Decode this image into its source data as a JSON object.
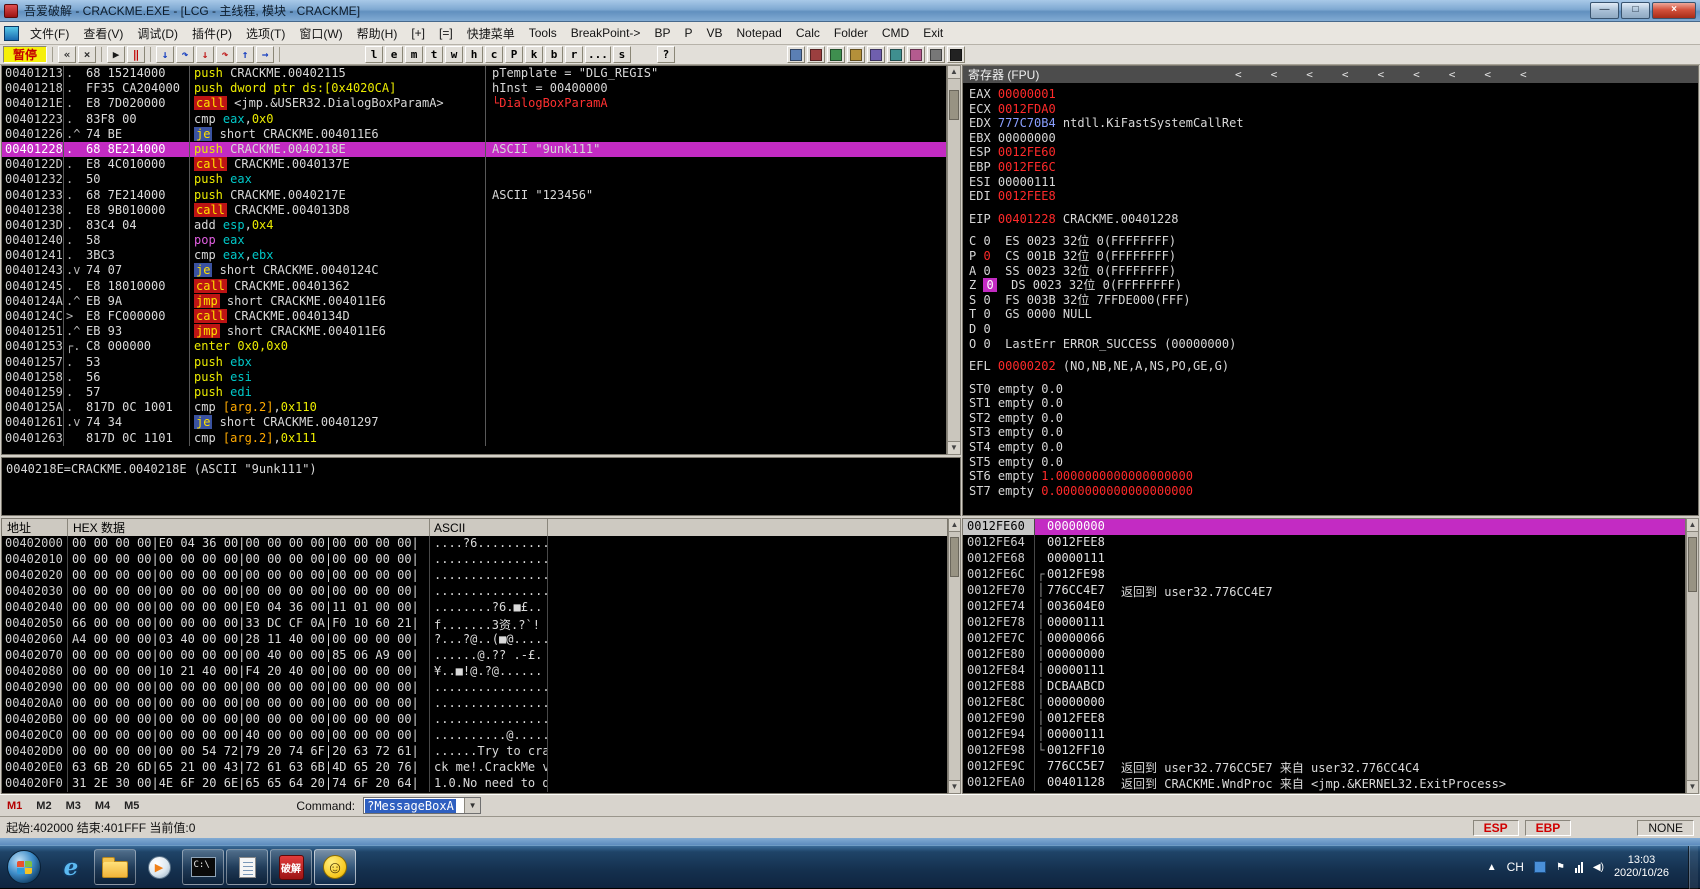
{
  "window": {
    "title": "吾爱破解 - CRACKME.EXE - [LCG - 主线程, 模块 - CRACKME]",
    "min_label": "—",
    "max_label": "□",
    "close_label": "×"
  },
  "menu": {
    "items": [
      "文件(F)",
      "查看(V)",
      "调试(D)",
      "插件(P)",
      "选项(T)",
      "窗口(W)",
      "帮助(H)",
      "[+]",
      "[=]",
      "快捷菜单",
      "Tools",
      "BreakPoint->",
      "BP",
      "P",
      "VB",
      "Notepad",
      "Calc",
      "Folder",
      "CMD",
      "Exit"
    ]
  },
  "toolbar": {
    "status": "暂停",
    "icon_buttons": [
      {
        "name": "restart-icon",
        "glyph": "«",
        "color": "#303030"
      },
      {
        "name": "close-program-icon",
        "glyph": "×",
        "color": "#303030"
      },
      {
        "name": "run-icon",
        "glyph": "▶",
        "color": "#1a1a1a"
      },
      {
        "name": "pause-icon",
        "glyph": "‖",
        "color": "#c00000"
      },
      {
        "name": "step-into-icon",
        "glyph": "↓",
        "color": "#1840c0"
      },
      {
        "name": "step-over-icon",
        "glyph": "↷",
        "color": "#1840c0"
      },
      {
        "name": "animate-into-icon",
        "glyph": "↓",
        "color": "#c02020"
      },
      {
        "name": "animate-over-icon",
        "glyph": "↷",
        "color": "#c02020"
      },
      {
        "name": "execute-till-return-icon",
        "glyph": "↑",
        "color": "#1840c0"
      },
      {
        "name": "go-to-user-code-icon",
        "glyph": "→",
        "color": "#1840c0"
      }
    ],
    "letter_buttons": [
      "l",
      "e",
      "m",
      "t",
      "w",
      "h",
      "c",
      "P",
      "k",
      "b",
      "r",
      "...",
      "s"
    ],
    "help_button": "?",
    "plugin_buttons": [
      {
        "name": "plugin-icon-1",
        "color": "#5b7fb4"
      },
      {
        "name": "plugin-icon-2",
        "color": "#9b3f3f"
      },
      {
        "name": "plugin-icon-3",
        "color": "#3f8f4f"
      },
      {
        "name": "plugin-icon-4",
        "color": "#b4903a"
      },
      {
        "name": "plugin-icon-5",
        "color": "#6f5fae"
      },
      {
        "name": "plugin-icon-6",
        "color": "#3f8f8f"
      },
      {
        "name": "plugin-icon-7",
        "color": "#b45b8f"
      },
      {
        "name": "plugin-icon-8",
        "color": "#777777"
      },
      {
        "name": "plugin-icon-9",
        "color": "#222222"
      }
    ]
  },
  "disasm": {
    "rows": [
      {
        "a": "00401213",
        "m": ".",
        "b": "68 15214000",
        "i": [
          [
            "y",
            "push"
          ],
          [
            "w",
            " CRACKME.00402115"
          ]
        ],
        "c": "pTemplate = \"DLG_REGIS\"",
        "cc": "cw"
      },
      {
        "a": "00401218",
        "m": ".",
        "b": "FF35 CA204000",
        "i": [
          [
            "y",
            "push"
          ],
          [
            "y",
            " dword ptr ds:[0x4020CA]"
          ]
        ],
        "c": "hInst = 00400000",
        "cc": "cw"
      },
      {
        "a": "0040121E",
        "m": ".",
        "b": "E8 7D020000",
        "i": [
          [
            "kc",
            "call"
          ],
          [
            "w",
            " <jmp.&USER32.DialogBoxParamA>"
          ]
        ],
        "c": "└DialogBoxParamA",
        "cc": "cr"
      },
      {
        "a": "00401223",
        "m": ".",
        "b": "83F8 00",
        "i": [
          [
            "w",
            "cmp "
          ],
          [
            "c",
            "eax"
          ],
          [
            "w",
            ","
          ],
          [
            "y",
            "0x0"
          ]
        ]
      },
      {
        "a": "00401226",
        "m": ".^",
        "b": "74 BE",
        "i": [
          [
            "ke",
            "je"
          ],
          [
            "w",
            " short CRACKME.004011E6"
          ]
        ]
      },
      {
        "a": "00401228",
        "m": ".",
        "b": "68 8E214000",
        "i": [
          [
            "y",
            "push"
          ],
          [
            "w",
            " CRACKME.0040218E"
          ]
        ],
        "c": "ASCII \"9unk111\"",
        "cc": "cw",
        "hl": true
      },
      {
        "a": "0040122D",
        "m": ".",
        "b": "E8 4C010000",
        "i": [
          [
            "kc",
            "call"
          ],
          [
            "w",
            " CRACKME.0040137E"
          ]
        ]
      },
      {
        "a": "00401232",
        "m": ".",
        "b": "50",
        "i": [
          [
            "y",
            "push"
          ],
          [
            "c",
            " eax"
          ]
        ]
      },
      {
        "a": "00401233",
        "m": ".",
        "b": "68 7E214000",
        "i": [
          [
            "y",
            "push"
          ],
          [
            "w",
            " CRACKME.0040217E"
          ]
        ],
        "c": "ASCII \"123456\"",
        "cc": "cw"
      },
      {
        "a": "00401238",
        "m": ".",
        "b": "E8 9B010000",
        "i": [
          [
            "kc",
            "call"
          ],
          [
            "w",
            " CRACKME.004013D8"
          ]
        ]
      },
      {
        "a": "0040123D",
        "m": ".",
        "b": "83C4 04",
        "i": [
          [
            "w",
            "add "
          ],
          [
            "c",
            "esp"
          ],
          [
            "w",
            ","
          ],
          [
            "y",
            "0x4"
          ]
        ]
      },
      {
        "a": "00401240",
        "m": ".",
        "b": "58",
        "i": [
          [
            "p",
            "pop"
          ],
          [
            "c",
            " eax"
          ]
        ]
      },
      {
        "a": "00401241",
        "m": ".",
        "b": "3BC3",
        "i": [
          [
            "w",
            "cmp "
          ],
          [
            "c",
            "eax"
          ],
          [
            "w",
            ","
          ],
          [
            "c",
            "ebx"
          ]
        ]
      },
      {
        "a": "00401243",
        "m": ".v",
        "b": "74 07",
        "i": [
          [
            "ke",
            "je"
          ],
          [
            "w",
            " short CRACKME.0040124C"
          ]
        ]
      },
      {
        "a": "00401245",
        "m": ".",
        "b": "E8 18010000",
        "i": [
          [
            "kc",
            "call"
          ],
          [
            "w",
            " CRACKME.00401362"
          ]
        ]
      },
      {
        "a": "0040124A",
        "m": ".^",
        "b": "EB 9A",
        "i": [
          [
            "kj",
            "jmp"
          ],
          [
            "w",
            " short CRACKME.004011E6"
          ]
        ]
      },
      {
        "a": "0040124C",
        "m": ">",
        "b": "E8 FC000000",
        "i": [
          [
            "kc",
            "call"
          ],
          [
            "w",
            " CRACKME.0040134D"
          ]
        ]
      },
      {
        "a": "00401251",
        "m": ".^",
        "b": "EB 93",
        "i": [
          [
            "kj",
            "jmp"
          ],
          [
            "w",
            " short CRACKME.004011E6"
          ]
        ]
      },
      {
        "a": "00401253",
        "m": "┌.",
        "b": "C8 000000",
        "i": [
          [
            "y",
            "enter"
          ],
          [
            "y",
            " 0x0,0x0"
          ]
        ]
      },
      {
        "a": "00401257",
        "m": ".",
        "b": "53",
        "i": [
          [
            "y",
            "push"
          ],
          [
            "c",
            " ebx"
          ]
        ]
      },
      {
        "a": "00401258",
        "m": ".",
        "b": "56",
        "i": [
          [
            "y",
            "push"
          ],
          [
            "c",
            " esi"
          ]
        ]
      },
      {
        "a": "00401259",
        "m": ".",
        "b": "57",
        "i": [
          [
            "y",
            "push"
          ],
          [
            "c",
            " edi"
          ]
        ]
      },
      {
        "a": "0040125A",
        "m": ".",
        "b": "817D 0C 1001",
        "i": [
          [
            "w",
            "cmp "
          ],
          [
            "o",
            "[arg.2]"
          ],
          [
            "w",
            ","
          ],
          [
            "y",
            "0x110"
          ]
        ]
      },
      {
        "a": "00401261",
        "m": ".v",
        "b": "74 34",
        "i": [
          [
            "ke",
            "je"
          ],
          [
            "w",
            " short CRACKME.00401297"
          ]
        ]
      },
      {
        "a": "00401263",
        "m": "",
        "b": "817D 0C 1101",
        "i": [
          [
            "w",
            "cmp "
          ],
          [
            "o",
            "[arg.2]"
          ],
          [
            "w",
            ","
          ],
          [
            "y",
            "0x111"
          ]
        ]
      }
    ]
  },
  "info_pane": {
    "text": "0040218E=CRACKME.0040218E (ASCII \"9unk111\")"
  },
  "registers": {
    "title": "寄存器 (FPU)",
    "chevron": "<",
    "chevron_count": 9,
    "lines": [
      {
        "s": [
          [
            "w",
            "EAX "
          ],
          [
            "r",
            "00000001"
          ]
        ]
      },
      {
        "s": [
          [
            "w",
            "ECX "
          ],
          [
            "r",
            "0012FDA0"
          ]
        ]
      },
      {
        "s": [
          [
            "w",
            "EDX "
          ],
          [
            "b",
            "777C70B4"
          ],
          [
            "w",
            " ntdll.KiFastSystemCallRet"
          ]
        ]
      },
      {
        "s": [
          [
            "w",
            "EBX "
          ],
          [
            "w",
            "00000000"
          ]
        ]
      },
      {
        "s": [
          [
            "w",
            "ESP "
          ],
          [
            "r",
            "0012FE60"
          ]
        ]
      },
      {
        "s": [
          [
            "w",
            "EBP "
          ],
          [
            "r",
            "0012FE6C"
          ]
        ]
      },
      {
        "s": [
          [
            "w",
            "ESI "
          ],
          [
            "w",
            "00000111"
          ]
        ]
      },
      {
        "s": [
          [
            "w",
            "EDI "
          ],
          [
            "r",
            "0012FEE8"
          ]
        ]
      },
      {
        "gap": true
      },
      {
        "s": [
          [
            "w",
            "EIP "
          ],
          [
            "r",
            "00401228"
          ],
          [
            "w",
            " CRACKME.00401228"
          ]
        ]
      },
      {
        "gap": true
      },
      {
        "s": [
          [
            "w",
            "C 0  ES 0023 32位 0(FFFFFFFF)"
          ]
        ]
      },
      {
        "s": [
          [
            "w",
            "P "
          ],
          [
            "r",
            "0"
          ],
          [
            "w",
            "  CS 001B 32位 0(FFFFFFFF)"
          ]
        ]
      },
      {
        "s": [
          [
            "w",
            "A 0  SS 0023 32位 0(FFFFFFFF)"
          ]
        ]
      },
      {
        "s": [
          [
            "w",
            "Z "
          ],
          [
            "zm",
            "0"
          ],
          [
            "w",
            "  DS 0023 32位 0(FFFFFFFF)"
          ]
        ]
      },
      {
        "s": [
          [
            "w",
            "S 0  FS 003B 32位 7FFDE000(FFF)"
          ]
        ]
      },
      {
        "s": [
          [
            "w",
            "T 0  GS 0000 NULL"
          ]
        ]
      },
      {
        "s": [
          [
            "w",
            "D 0"
          ]
        ]
      },
      {
        "s": [
          [
            "w",
            "O 0  LastErr ERROR_SUCCESS (00000000)"
          ]
        ]
      },
      {
        "gap": true
      },
      {
        "s": [
          [
            "w",
            "EFL "
          ],
          [
            "r",
            "00000202"
          ],
          [
            "w",
            " (NO,NB,NE,A,NS,PO,GE,G)"
          ]
        ]
      },
      {
        "gap": true
      },
      {
        "s": [
          [
            "w",
            "ST0 empty 0.0"
          ]
        ]
      },
      {
        "s": [
          [
            "w",
            "ST1 empty 0.0"
          ]
        ]
      },
      {
        "s": [
          [
            "w",
            "ST2 empty 0.0"
          ]
        ]
      },
      {
        "s": [
          [
            "w",
            "ST3 empty 0.0"
          ]
        ]
      },
      {
        "s": [
          [
            "w",
            "ST4 empty 0.0"
          ]
        ]
      },
      {
        "s": [
          [
            "w",
            "ST5 empty 0.0"
          ]
        ]
      },
      {
        "s": [
          [
            "w",
            "ST6 empty "
          ],
          [
            "r",
            "1.0000000000000000000"
          ]
        ]
      },
      {
        "s": [
          [
            "w",
            "ST7 empty "
          ],
          [
            "r",
            "0.0000000000000000000"
          ]
        ]
      }
    ]
  },
  "dump": {
    "headers": {
      "addr": "地址",
      "hex": "HEX 数据",
      "ascii": "ASCII"
    },
    "rows": [
      {
        "a": "00402000",
        "h": "00 00 00 00|E0 04 36 00|00 00 00 00|00 00 00 00|",
        "t": "....?6.........."
      },
      {
        "a": "00402010",
        "h": "00 00 00 00|00 00 00 00|00 00 00 00|00 00 00 00|",
        "t": "................"
      },
      {
        "a": "00402020",
        "h": "00 00 00 00|00 00 00 00|00 00 00 00|00 00 00 00|",
        "t": "................"
      },
      {
        "a": "00402030",
        "h": "00 00 00 00|00 00 00 00|00 00 00 00|00 00 00 00|",
        "t": "................"
      },
      {
        "a": "00402040",
        "h": "00 00 00 00|00 00 00 00|E0 04 36 00|11 01 00 00|",
        "t": "........?6.■£.."
      },
      {
        "a": "00402050",
        "h": "66 00 00 00|00 00 00 00|33 DC CF 0A|F0 10 60 21|",
        "t": "f.......3资.?`!"
      },
      {
        "a": "00402060",
        "h": "A4 00 00 00|03 40 00 00|28 11 40 00|00 00 00 00|",
        "t": "?...?@..(■@....."
      },
      {
        "a": "00402070",
        "h": "00 00 00 00|00 00 00 00|00 40 00 00|85 06 A9 00|",
        "t": "......@.?? .-£."
      },
      {
        "a": "00402080",
        "h": "00 00 00 00|10 21 40 00|F4 20 40 00|00 00 00 00|",
        "t": "¥..■!@.?@......"
      },
      {
        "a": "00402090",
        "h": "00 00 00 00|00 00 00 00|00 00 00 00|00 00 00 00|",
        "t": "................"
      },
      {
        "a": "004020A0",
        "h": "00 00 00 00|00 00 00 00|00 00 00 00|00 00 00 00|",
        "t": "................"
      },
      {
        "a": "004020B0",
        "h": "00 00 00 00|00 00 00 00|00 00 00 00|00 00 00 00|",
        "t": "................"
      },
      {
        "a": "004020C0",
        "h": "00 00 00 00|00 00 00 00|40 00 00 00|00 00 00 00|",
        "t": "..........@....."
      },
      {
        "a": "004020D0",
        "h": "00 00 00 00|00 00 54 72|79 20 74 6F|20 63 72 61|",
        "t": "......Try to cra"
      },
      {
        "a": "004020E0",
        "h": "63 6B 20 6D|65 21 00 43|72 61 63 6B|4D 65 20 76|",
        "t": "ck me!.CrackMe v"
      },
      {
        "a": "004020F0",
        "h": "31 2E 30 00|4E 6F 20 6E|65 65 64 20|74 6F 20 64|",
        "t": "1.0.No need to d"
      }
    ]
  },
  "stack": {
    "rows": [
      {
        "a": "0012FE60",
        "v": "00000000",
        "hl": true
      },
      {
        "a": "0012FE64",
        "v": "0012FEE8"
      },
      {
        "a": "0012FE68",
        "v": "00000111"
      },
      {
        "a": "0012FE6C",
        "v": "0012FE98",
        "br": "┌"
      },
      {
        "a": "0012FE70",
        "v": "776CC4E7",
        "br": "│",
        "c": "返回到 user32.776CC4E7"
      },
      {
        "a": "0012FE74",
        "v": "003604E0",
        "br": "│"
      },
      {
        "a": "0012FE78",
        "v": "00000111",
        "br": "│"
      },
      {
        "a": "0012FE7C",
        "v": "00000066",
        "br": "│"
      },
      {
        "a": "0012FE80",
        "v": "00000000",
        "br": "│"
      },
      {
        "a": "0012FE84",
        "v": "00000111",
        "br": "│"
      },
      {
        "a": "0012FE88",
        "v": "DCBAABCD",
        "br": "│"
      },
      {
        "a": "0012FE8C",
        "v": "00000000",
        "br": "│"
      },
      {
        "a": "0012FE90",
        "v": "0012FEE8",
        "br": "│"
      },
      {
        "a": "0012FE94",
        "v": "00000111",
        "br": "│"
      },
      {
        "a": "0012FE98",
        "v": "0012FF10",
        "br": "└"
      },
      {
        "a": "0012FE9C",
        "v": "776CC5E7",
        "c": "返回到 user32.776CC5E7 来自 user32.776CC4C4"
      },
      {
        "a": "0012FEA0",
        "v": "00401128",
        "c": "返回到 CRACKME.WndProc 来自 <jmp.&KERNEL32.ExitProcess>"
      }
    ]
  },
  "command_bar": {
    "m_buttons": [
      "M1",
      "M2",
      "M3",
      "M4",
      "M5"
    ],
    "label": "Command:",
    "value": "?MessageBoxA"
  },
  "status_bar": {
    "left": "起始:402000 结束:401FFF 当前值:0",
    "esp": "ESP",
    "ebp": "EBP",
    "right": "NONE"
  },
  "taskbar": {
    "ie": "e",
    "cmd_label": "C:\\",
    "wmp": "▶",
    "pojie": "破解",
    "smiley": "☺",
    "hidden": "▲",
    "lang": "CH",
    "flag": "⚑",
    "volume": "◀)",
    "time": "13:03",
    "date": "2020/10/26"
  }
}
